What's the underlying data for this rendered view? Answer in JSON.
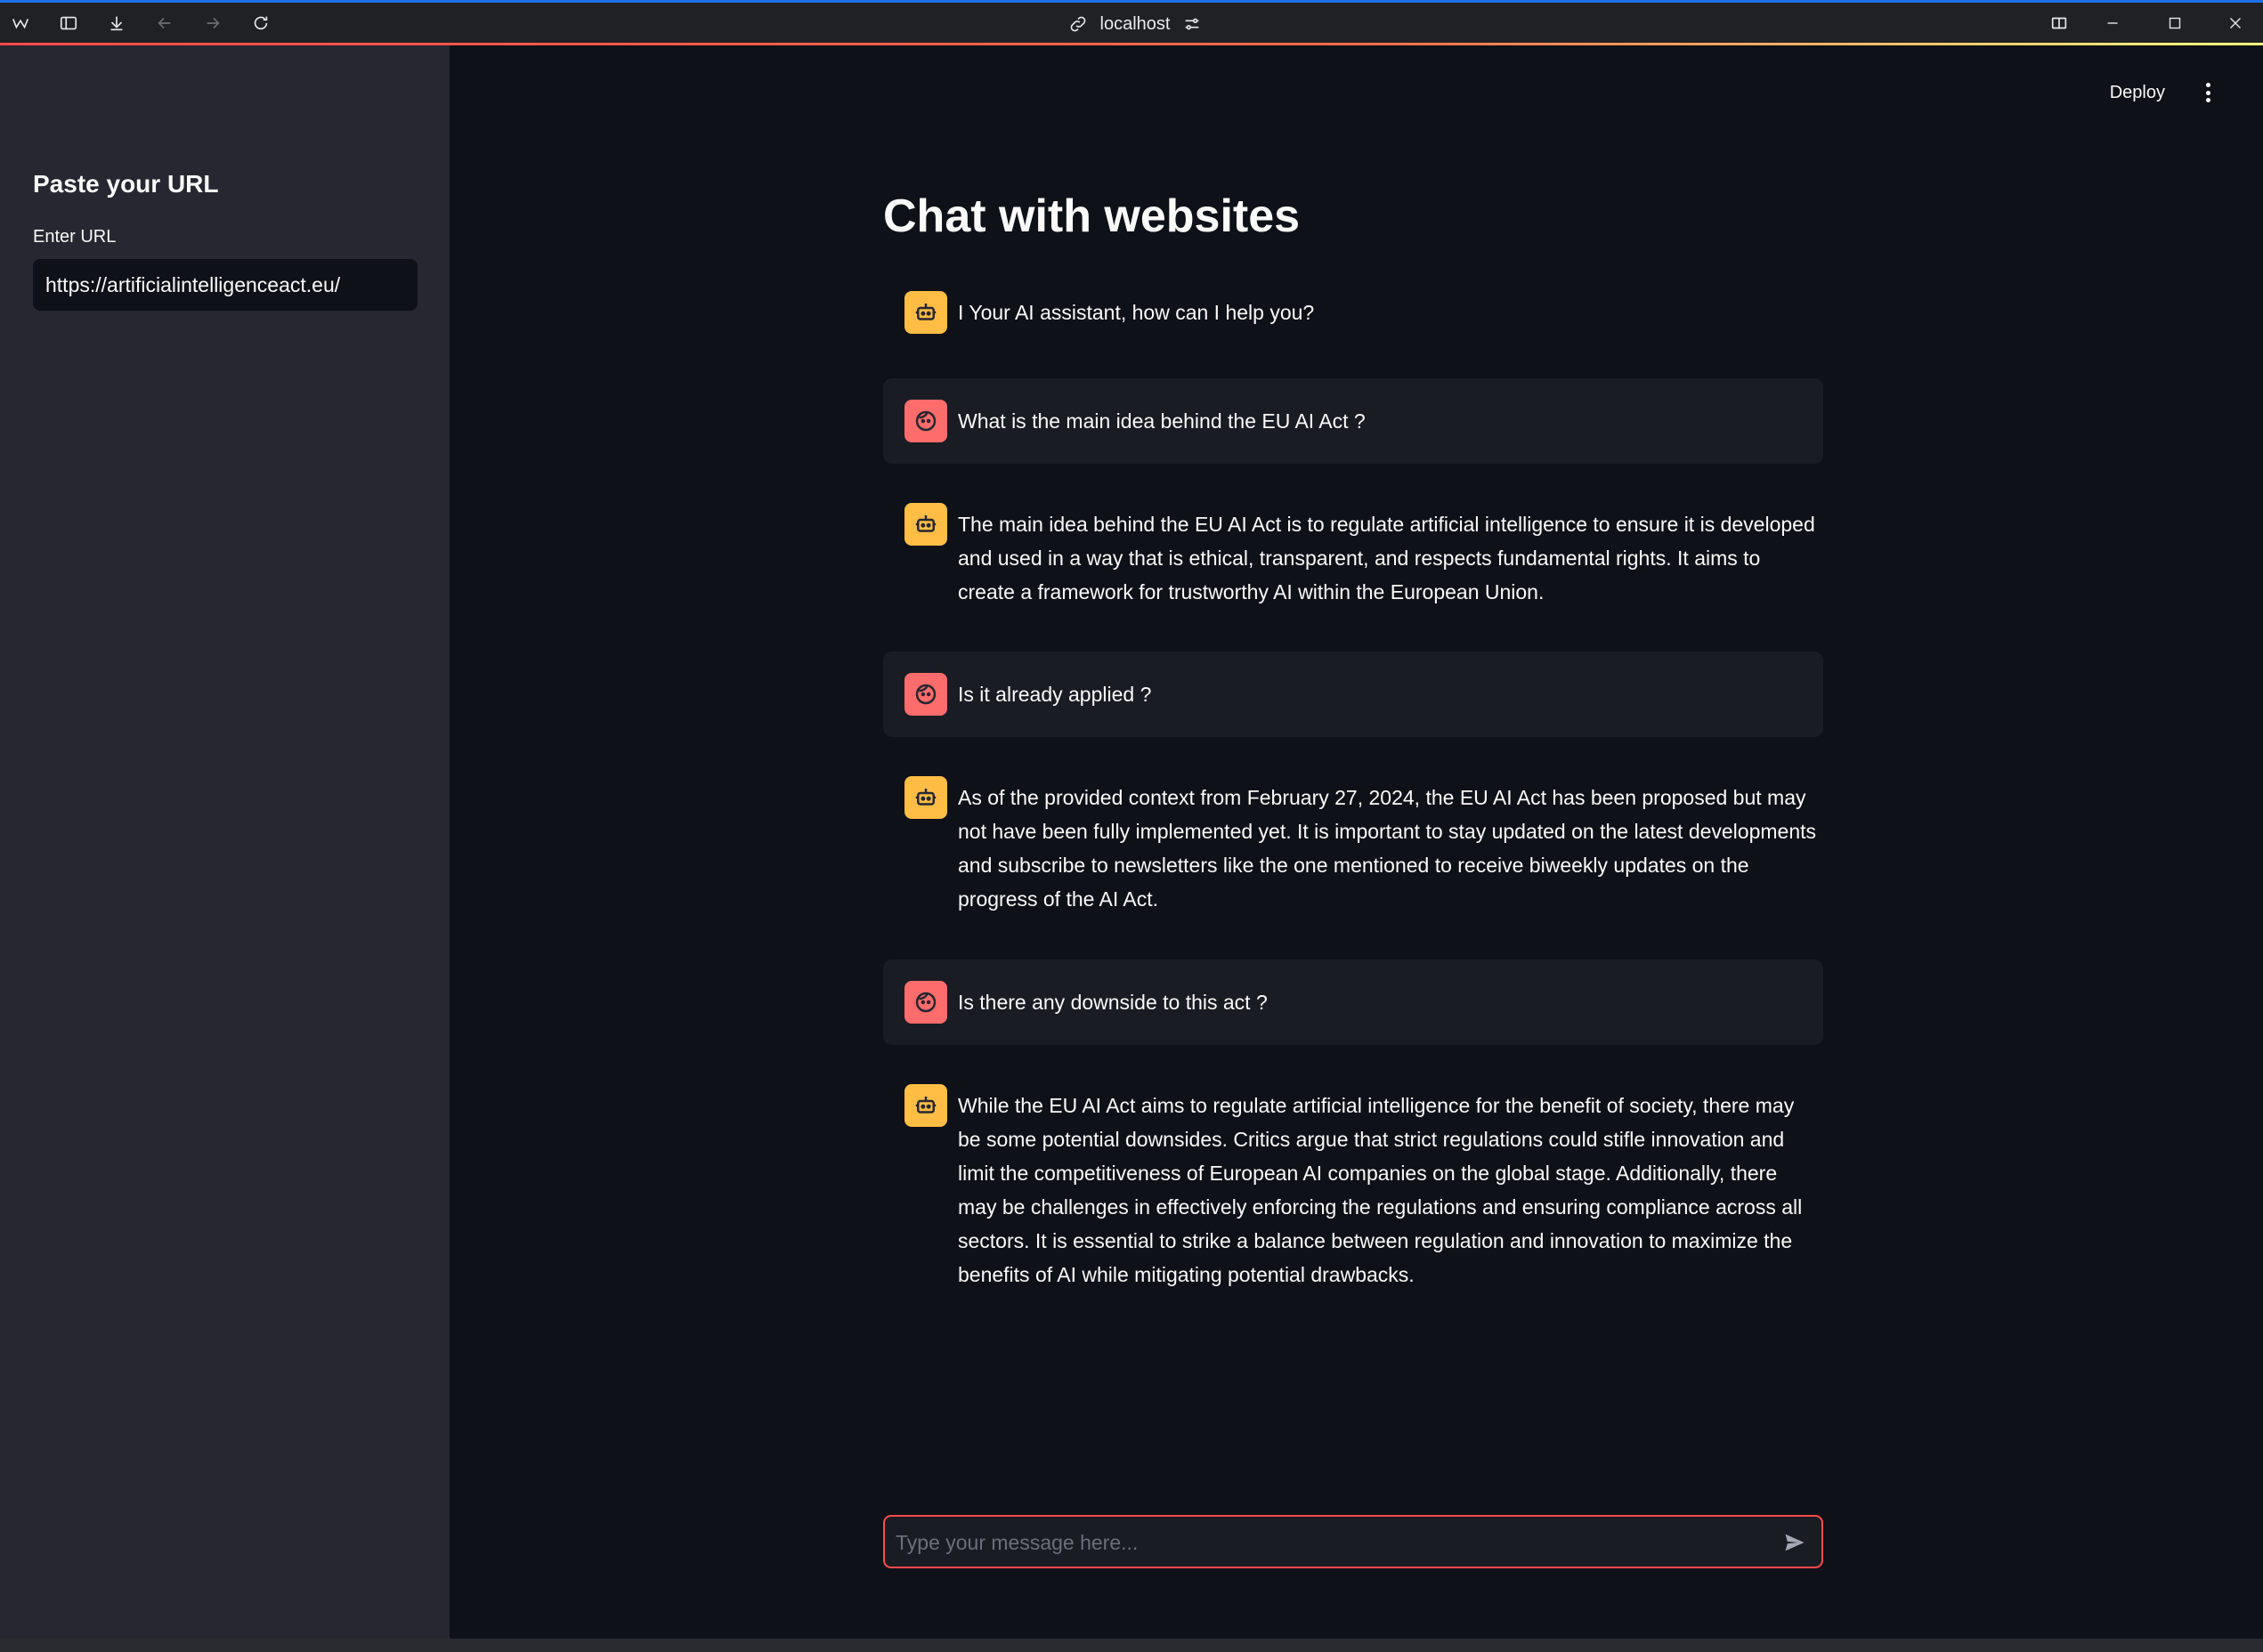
{
  "browser": {
    "address": "localhost",
    "icons": [
      "app-logo-icon",
      "sidebar-toggle-icon",
      "download-icon",
      "back-icon",
      "forward-icon",
      "reload-icon",
      "link-icon",
      "site-settings-icon",
      "split-view-icon",
      "minimize-icon",
      "maximize-icon",
      "close-icon"
    ]
  },
  "sidebar": {
    "title": "Paste your URL",
    "url_label": "Enter URL",
    "url_value": "https://artificialintelligenceact.eu/"
  },
  "header": {
    "deploy_label": "Deploy"
  },
  "main": {
    "title": "Chat with websites",
    "messages": [
      {
        "role": "bot",
        "text": "I Your AI assistant, how can I help you?"
      },
      {
        "role": "user",
        "text": "What is the main idea behind the EU AI Act ?"
      },
      {
        "role": "bot",
        "text": "The main idea behind the EU AI Act is to regulate artificial intelligence to ensure it is developed and used in a way that is ethical, transparent, and respects fundamental rights. It aims to create a framework for trustworthy AI within the European Union."
      },
      {
        "role": "user",
        "text": "Is it already applied ?"
      },
      {
        "role": "bot",
        "text": "As of the provided context from February 27, 2024, the EU AI Act has been proposed but may not have been fully implemented yet. It is important to stay updated on the latest developments and subscribe to newsletters like the one mentioned to receive biweekly updates on the progress of the AI Act."
      },
      {
        "role": "user",
        "text": "Is there any downside to this act ?"
      },
      {
        "role": "bot",
        "text": "While the EU AI Act aims to regulate artificial intelligence for the benefit of society, there may be some potential downsides. Critics argue that strict regulations could stifle innovation and limit the competitiveness of European AI companies on the global stage. Additionally, there may be challenges in effectively enforcing the regulations and ensuring compliance across all sectors. It is essential to strike a balance between regulation and innovation to maximize the benefits of AI while mitigating potential drawbacks."
      }
    ],
    "chat_placeholder": "Type your message here..."
  },
  "colors": {
    "accent": "#ff4b4b",
    "bot_avatar": "#ffbd45",
    "user_avatar": "#ff6c6c",
    "background": "#0e1117",
    "sidebar": "#262730"
  }
}
